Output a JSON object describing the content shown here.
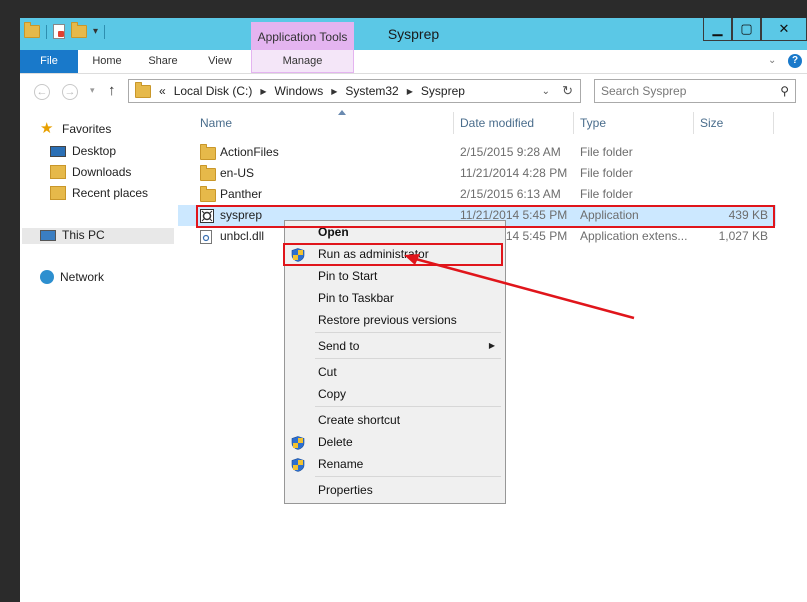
{
  "window": {
    "title": "Sysprep",
    "context_tab_group": "Application Tools"
  },
  "ribbon": {
    "tabs": [
      "File",
      "Home",
      "Share",
      "View",
      "Manage"
    ]
  },
  "address": {
    "overflow": "«",
    "path": [
      "Local Disk (C:)",
      "Windows",
      "System32",
      "Sysprep"
    ]
  },
  "search": {
    "placeholder": "Search Sysprep"
  },
  "nav": {
    "favorites": "Favorites",
    "desktop": "Desktop",
    "downloads": "Downloads",
    "recent": "Recent places",
    "thispc": "This PC",
    "network": "Network"
  },
  "columns": {
    "name": "Name",
    "date": "Date modified",
    "type": "Type",
    "size": "Size"
  },
  "files": [
    {
      "name": "ActionFiles",
      "date": "2/15/2015 9:28 AM",
      "type": "File folder",
      "size": ""
    },
    {
      "name": "en-US",
      "date": "11/21/2014 4:28 PM",
      "type": "File folder",
      "size": ""
    },
    {
      "name": "Panther",
      "date": "2/15/2015 6:13 AM",
      "type": "File folder",
      "size": ""
    },
    {
      "name": "sysprep",
      "date": "11/21/2014 5:45 PM",
      "type": "Application",
      "size": "439 KB"
    },
    {
      "name": "unbcl.dll",
      "date": "11/21/2014 5:45 PM",
      "type": "Application extens...",
      "size": "1,027 KB"
    }
  ],
  "context_menu": {
    "open": "Open",
    "run_as_admin": "Run as administrator",
    "pin_start": "Pin to Start",
    "pin_taskbar": "Pin to Taskbar",
    "restore": "Restore previous versions",
    "send_to": "Send to",
    "cut": "Cut",
    "copy": "Copy",
    "create_shortcut": "Create shortcut",
    "delete": "Delete",
    "rename": "Rename",
    "properties": "Properties"
  },
  "colors": {
    "titlebar": "#5bc8e6",
    "file_tab": "#1979ca",
    "app_tools": "#e4b4f0",
    "highlight": "#e0151b",
    "selection": "#cce8ff"
  }
}
